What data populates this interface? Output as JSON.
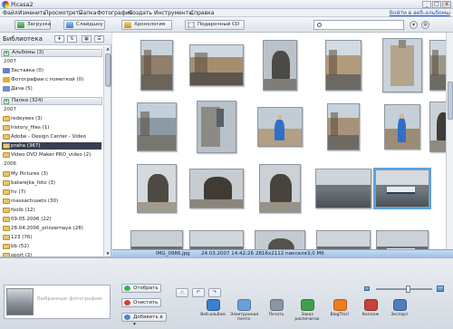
{
  "window": {
    "title": "Picasa2",
    "min": "_",
    "max": "□",
    "close": "x"
  },
  "menu": [
    "Файл",
    "Изменить",
    "Просмотреть",
    "Папка",
    "Фотография",
    "Создать",
    "Инструменты",
    "Справка"
  ],
  "signin_link": "Войти в веб-альбомы",
  "toolbar": {
    "import": "Загрузка",
    "slideshow": "Слайдшоу",
    "timeline": "Хронология",
    "cd": "Подарочный CD",
    "search_value": ""
  },
  "library": {
    "title": "Библиотека",
    "albums_group": "Альбомы (3)",
    "albums_year": "2007",
    "albums": [
      {
        "label": "Заставка (0)",
        "color": "#6f7ec9"
      },
      {
        "label": "Фотографии с пометкой (0)",
        "color": "#e0b030"
      },
      {
        "label": "Дача (5)",
        "color": "#6e8fc9"
      }
    ],
    "folders_group": "Папки (324)",
    "year_2007": "2007",
    "folders_2007": [
      "redeyees (3)",
      "history_files (1)",
      "Adobe - Design Center - Video",
      "praha (367)",
      "Video DVD Maker PRO_video (2)"
    ],
    "selected_folder_index": 3,
    "year_2006": "2006",
    "folders_2006": [
      "My Pictures (3)",
      "batarejka_foto (3)",
      "hv (7)",
      "massachusets (30)",
      "foolb (12)",
      "09.05.2006 (22)",
      "28.04.2006_priozernaya (28)",
      "123 (76)",
      "bb (52)",
      "sport (2)"
    ]
  },
  "status": {
    "filename": "IMG_0986.jpg",
    "datetime": "24.03.2007 14:42:26",
    "dimensions": "2816x2112 пикселя",
    "size": "3,0 Мб"
  },
  "tray": {
    "hold_hint": "Выбранные фотографии",
    "hold_button": "Отобрать",
    "clear_button": "Очистить",
    "add_button": "Добавить в ▾",
    "shares": [
      {
        "label": "Веб-альбом",
        "color": "#3a7fd0"
      },
      {
        "label": "Электронная почта",
        "color": "#6aa0d8"
      },
      {
        "label": "Печать",
        "color": "#8a96a4"
      },
      {
        "label": "Заказ распечаток",
        "color": "#3fa04b"
      },
      {
        "label": "BlogThis!",
        "color": "#f07c1e"
      },
      {
        "label": "Коллаж",
        "color": "#c8413a"
      },
      {
        "label": "Экспорт",
        "color": "#4d7fbf"
      }
    ]
  },
  "thumbnails": [
    {
      "kind": "street",
      "colors": [
        "#c9d3dc",
        "#8f7f6c",
        "#6b6458"
      ]
    },
    {
      "kind": "square",
      "colors": [
        "#cdd8e2",
        "#a58e6e",
        "#5b5750"
      ]
    },
    {
      "kind": "statue",
      "colors": [
        "#b9c2c9",
        "#4b4a45",
        "#7f7d76"
      ]
    },
    {
      "kind": "street",
      "colors": [
        "#d2dbe2",
        "#b29b7c",
        "#6d6a64"
      ]
    },
    {
      "kind": "tower",
      "colors": [
        "#c7d2dc",
        "#b5a48b",
        "#8f8a80"
      ]
    },
    {
      "kind": "street",
      "colors": [
        "#cfd7de",
        "#9c9788",
        "#6d6b64"
      ]
    },
    {
      "kind": "street",
      "colors": [
        "#c3cfda",
        "#8c9aa3",
        "#777770"
      ]
    },
    {
      "kind": "lamp",
      "colors": [
        "#b7c1c9",
        "#5a6067",
        "#8c8a84"
      ]
    },
    {
      "kind": "person",
      "colors": [
        "#c2ccd4",
        "#b29f84",
        "#6b6760"
      ]
    },
    {
      "kind": "square",
      "colors": [
        "#c8d2da",
        "#a5927a",
        "#6e6a62"
      ]
    },
    {
      "kind": "person",
      "colors": [
        "#c5cfd7",
        "#9c8c75",
        "#5e5a54"
      ]
    },
    {
      "kind": "statue",
      "colors": [
        "#c9d1d6",
        "#3f3c37",
        "#8f8a80"
      ]
    },
    {
      "kind": "statue",
      "colors": [
        "#d3d9dd",
        "#4e4a43",
        "#a09a8f"
      ]
    },
    {
      "kind": "statue",
      "colors": [
        "#c6ccd0",
        "#403c35",
        "#8a857c"
      ]
    },
    {
      "kind": "statue",
      "colors": [
        "#cbd1d5",
        "#48443d",
        "#989286"
      ]
    },
    {
      "kind": "river",
      "colors": [
        "#cdd4da",
        "#6f767b",
        "#4a5055"
      ]
    },
    {
      "kind": "boat",
      "colors": [
        "#d4dade",
        "#707a80",
        "#4a5259"
      ]
    },
    {
      "kind": "river",
      "colors": [
        "#c9d0d5",
        "#676e72",
        "#464b4f"
      ]
    },
    {
      "kind": "river",
      "colors": [
        "#d0d6db",
        "#6a7177",
        "#4b5156"
      ]
    },
    {
      "kind": "statue",
      "colors": [
        "#c4cbd0",
        "#55524b",
        "#8c877d"
      ]
    },
    {
      "kind": "river",
      "colors": [
        "#cfd5da",
        "#687075",
        "#4a4f54"
      ]
    },
    {
      "kind": "boat",
      "colors": [
        "#cbd1d6",
        "#66707a",
        "#444b52"
      ]
    },
    {
      "kind": "river",
      "colors": [
        "#cdd3d8",
        "#6b7378",
        "#4c5257"
      ]
    },
    {
      "kind": "river",
      "colors": [
        "#cad1d6",
        "#6c7378",
        "#4a5055"
      ]
    },
    {
      "kind": "river",
      "colors": [
        "#ced4d9",
        "#6a7075",
        "#474d52"
      ]
    },
    {
      "kind": "river",
      "colors": [
        "#c8cfd4",
        "#6f767b",
        "#4c5156"
      ]
    }
  ],
  "selected_thumbnail": 16
}
